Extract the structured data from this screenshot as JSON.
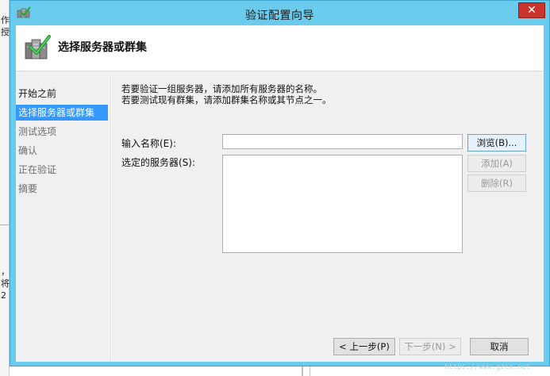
{
  "window": {
    "title": "验证配置向导"
  },
  "header": {
    "page_title": "选择服务器或群集"
  },
  "nav": {
    "items": [
      {
        "label": "开始之前",
        "state": "normal"
      },
      {
        "label": "选择服务器或群集",
        "state": "active"
      },
      {
        "label": "测试选项",
        "state": "disabled"
      },
      {
        "label": "确认",
        "state": "disabled"
      },
      {
        "label": "正在验证",
        "state": "disabled"
      },
      {
        "label": "摘要",
        "state": "disabled"
      }
    ]
  },
  "content": {
    "desc_line1": "若要验证一组服务器，请添加所有服务器的名称。",
    "desc_line2": "若要测试现有群集，请添加群集名称或其节点之一。",
    "name_label": "输入名称(E):",
    "name_value": "",
    "servers_label": "选定的服务器(S):",
    "browse_label": "浏览(B)...",
    "add_label": "添加(A)",
    "remove_label": "删除(R)"
  },
  "footer": {
    "prev_label": "< 上一步(P)",
    "next_label": "下一步(N) >",
    "cancel_label": "取消"
  },
  "background": {
    "left_text_1": "作",
    "left_text_2": "授",
    "left_text_3": "，",
    "left_text_4": "将",
    "left_text_5": "2",
    "watermark": "https://www.gzcx.net"
  },
  "colors": {
    "titlebar": "#6bcbec",
    "close_button": "#c7352c",
    "nav_active": "#3399ff",
    "client_bg": "#f0f0f0"
  }
}
